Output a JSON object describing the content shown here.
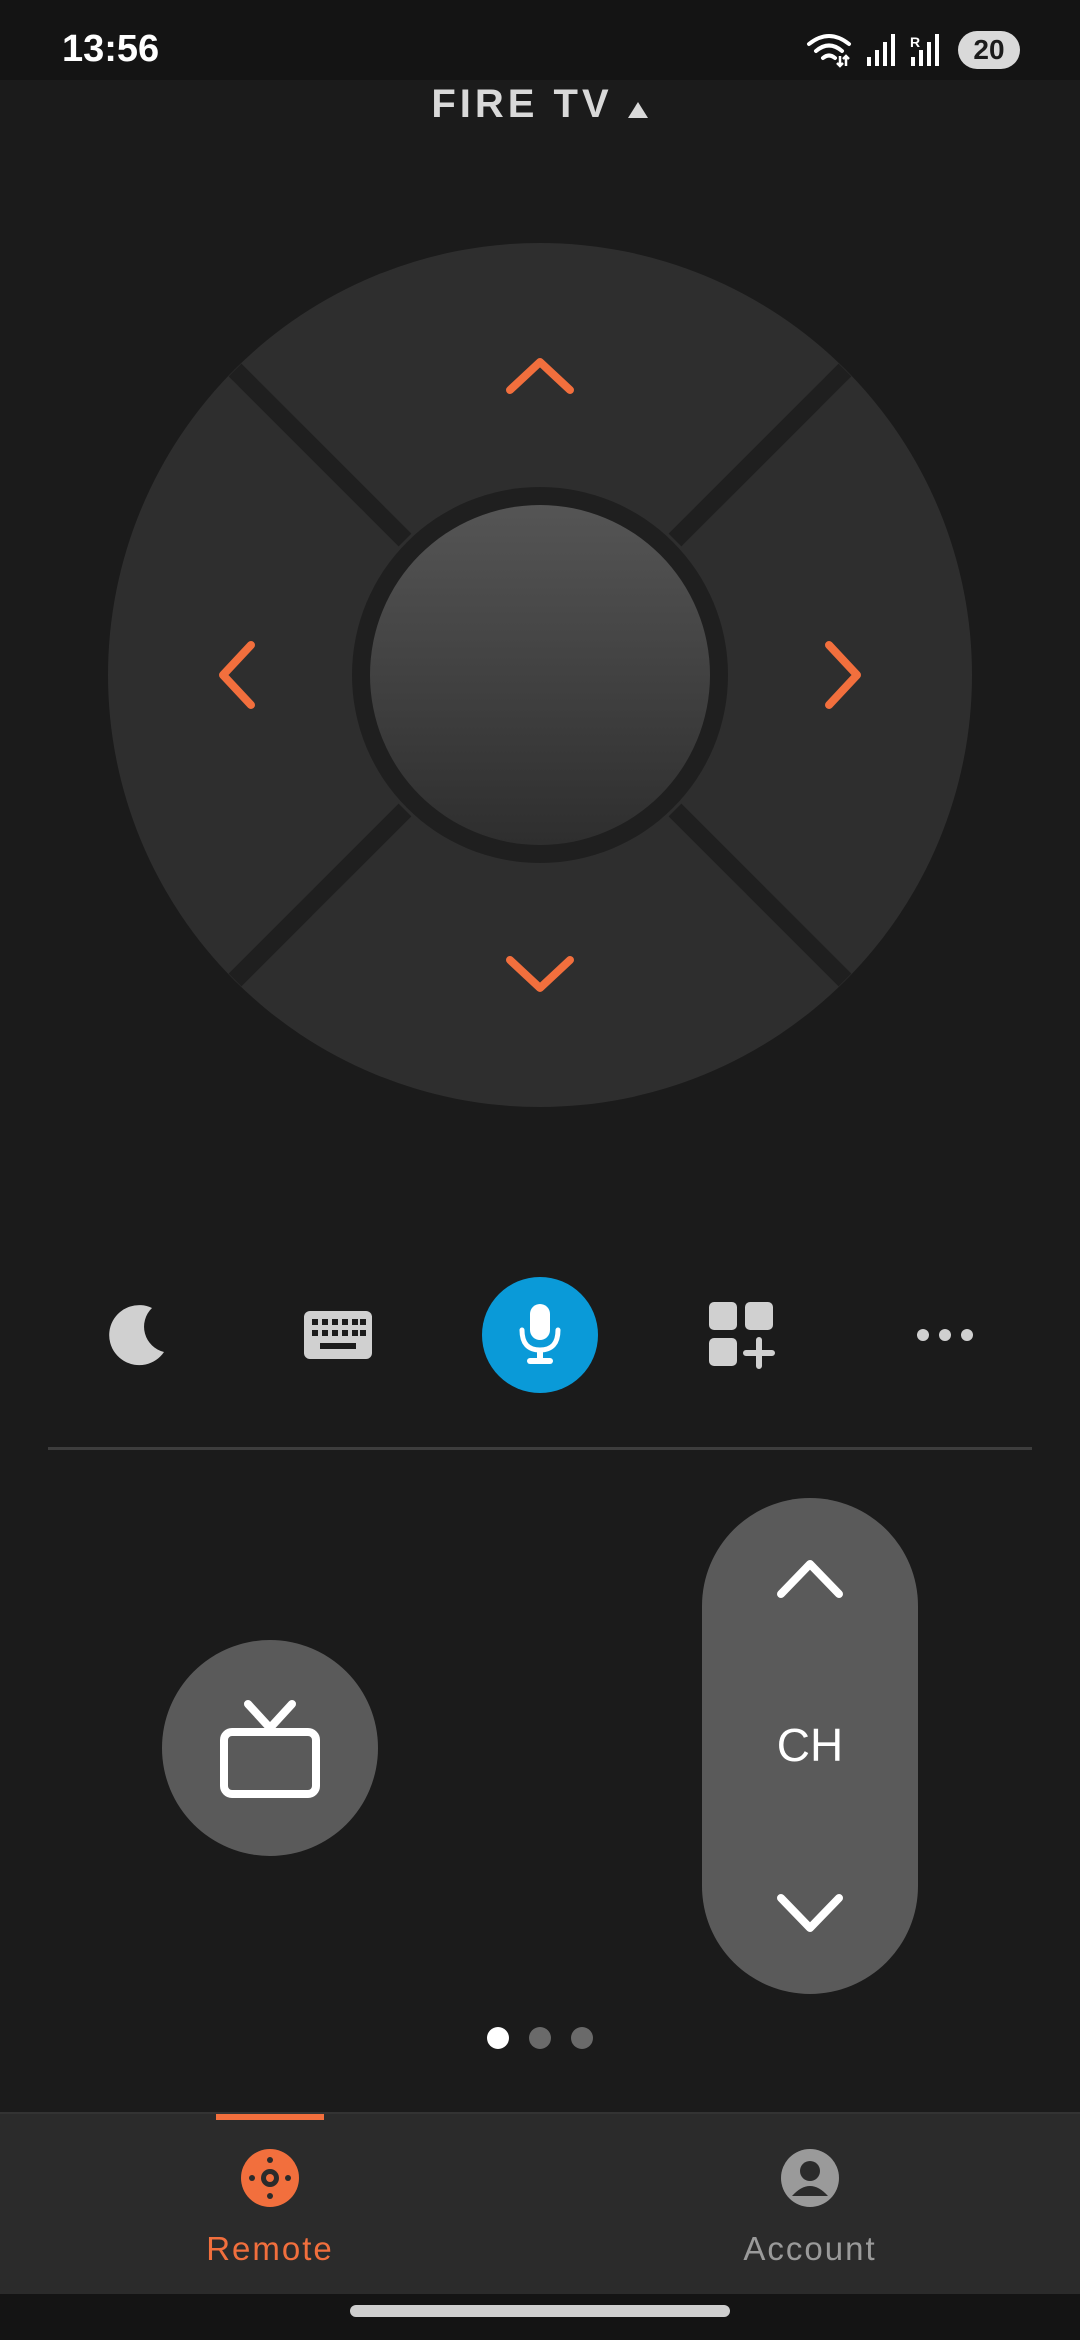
{
  "status_bar": {
    "time": "13:56",
    "battery": "20",
    "icons": [
      "wifi-icon",
      "signal-icon",
      "signal-roaming-icon",
      "battery-icon"
    ]
  },
  "header": {
    "device_name": "FIRE TV",
    "caret_icon": "caret-up-icon"
  },
  "dpad": {
    "up_icon": "chevron-up-icon",
    "down_icon": "chevron-down-icon",
    "left_icon": "chevron-left-icon",
    "right_icon": "chevron-right-icon",
    "select_icon": "select-button",
    "arrow_color": "#f26f3d"
  },
  "quick_actions": [
    {
      "icon": "moon-icon"
    },
    {
      "icon": "keyboard-icon"
    },
    {
      "icon": "microphone-icon",
      "accent": "#0a9ad8"
    },
    {
      "icon": "apps-add-icon"
    },
    {
      "icon": "more-icon"
    }
  ],
  "controls": {
    "tv_icon": "tv-icon",
    "channel_label": "CH"
  },
  "pager": {
    "current": 1,
    "total": 3
  },
  "bottom_nav": {
    "items": [
      {
        "label": "Remote",
        "icon": "remote-icon",
        "active": true
      },
      {
        "label": "Account",
        "icon": "account-icon",
        "active": false
      }
    ],
    "accent": "#f26f3d"
  }
}
